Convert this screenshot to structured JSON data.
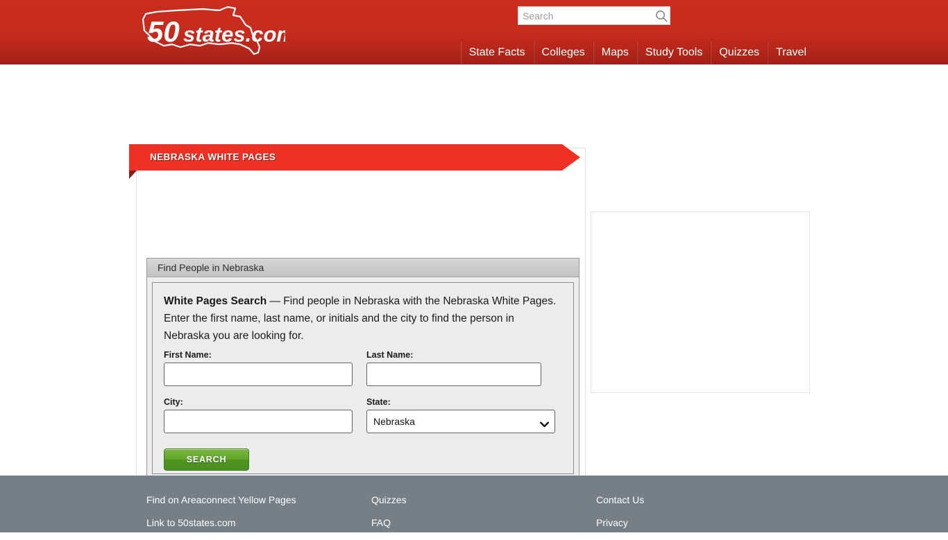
{
  "header": {
    "logo": {
      "name": "50states.com-logo",
      "number_text": "50",
      "word_text": "states",
      "tld_text": ".com"
    },
    "search": {
      "placeholder": "Search",
      "value": "",
      "icon": "search-icon"
    },
    "nav": [
      {
        "label": "State Facts"
      },
      {
        "label": "Colleges"
      },
      {
        "label": "Maps"
      },
      {
        "label": "Study Tools"
      },
      {
        "label": "Quizzes"
      },
      {
        "label": "Travel"
      }
    ]
  },
  "main": {
    "ribbon_title": "NEBRASKA WHITE PAGES",
    "panel_title": "Find People in Nebraska",
    "intro": {
      "lead": "White Pages Search",
      "body": " — Find people in Nebraska with the Nebraska White Pages. Enter the first name, last name, or initials and the city to find the person in Nebraska you are looking for."
    },
    "form": {
      "first_name": {
        "label": "First Name:",
        "value": "",
        "placeholder": ""
      },
      "last_name": {
        "label": "Last Name:",
        "value": "",
        "placeholder": ""
      },
      "city": {
        "label": "City:",
        "value": "",
        "placeholder": ""
      },
      "state": {
        "label": "State:",
        "selected": "Nebraska",
        "options": [
          "Nebraska"
        ],
        "chevron_icon": "chevron-down-icon"
      },
      "submit_label": "SEARCH"
    }
  },
  "footer": {
    "columns": [
      {
        "links": [
          {
            "label": "Find on Areaconnect Yellow Pages"
          },
          {
            "label": "Link to 50states.com"
          }
        ]
      },
      {
        "links": [
          {
            "label": "Quizzes"
          },
          {
            "label": "FAQ"
          }
        ]
      },
      {
        "links": [
          {
            "label": "Contact Us"
          },
          {
            "label": "Privacy"
          }
        ]
      }
    ]
  },
  "colors": {
    "header_red": "#c62b1d",
    "ribbon_red": "#ee3124",
    "ribbon_fold": "#8d1a12",
    "button_green": "#5ba329",
    "footer_gray": "#767f85"
  }
}
